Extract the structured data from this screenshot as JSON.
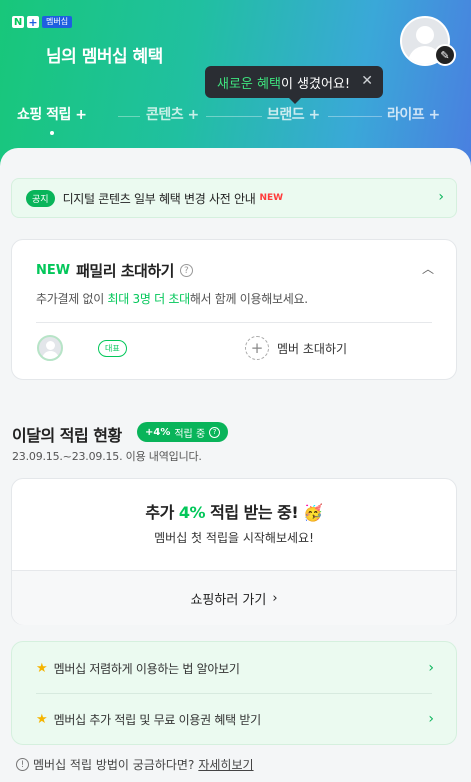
{
  "header": {
    "logo_n": "N",
    "logo_plus": "+",
    "logo_badge": "멤버십",
    "title": "님의 멤버십 혜택",
    "edit_icon": "✎"
  },
  "tooltip": {
    "highlight": "새로운 혜택",
    "rest": "이 생겼어요!",
    "close": "✕"
  },
  "tabs": [
    {
      "label": "쇼핑 적립",
      "plus": "+"
    },
    {
      "label": "콘텐츠",
      "plus": "+"
    },
    {
      "label": "브랜드",
      "plus": "+"
    },
    {
      "label": "라이프",
      "plus": "+"
    }
  ],
  "notice": {
    "tag": "공지",
    "text": "디지털 콘텐츠 일부 혜택 변경 사전 안내",
    "new": "NEW",
    "chevron": "›"
  },
  "family": {
    "new": "NEW",
    "title": "패밀리 초대하기",
    "help": "?",
    "caret": "︿",
    "desc_pre": "추가결제 없이 ",
    "desc_highlight": "최대 3명 더 초대",
    "desc_post": "해서 함께 이용해보세요.",
    "rep_badge": "대표",
    "invite_plus": "+",
    "invite_label": "멤버 초대하기"
  },
  "monthly": {
    "title": "이달의 적립 현황",
    "rate_pct": "+4%",
    "rate_label": "적립 중",
    "rate_help": "?",
    "period": "23.09.15.~23.09.15. 이용 내역입니다."
  },
  "earn": {
    "big_pre": "추가 ",
    "big_pct": "4%",
    "big_post": " 적립 받는 중!",
    "emoji": "🥳",
    "sub": "멤버십 첫 적립을 시작해보세요!",
    "cta": "쇼핑하러 가기",
    "cta_chev": "›"
  },
  "tips": [
    {
      "star": "★",
      "label": "멤버십 저렴하게 이용하는 법 알아보기",
      "chevron": "›"
    },
    {
      "star": "★",
      "label": "멤버십 추가 적립 및 무료 이용권 혜택 받기",
      "chevron": "›"
    }
  ],
  "help": {
    "icon": "!",
    "text": "멤버십 적립 방법이 궁금하다면?",
    "link": "자세히보기"
  },
  "colors": {
    "accent_green": "#03c75a",
    "header_gradient_start": "#18c77a",
    "header_gradient_end": "#4a7fe0"
  }
}
